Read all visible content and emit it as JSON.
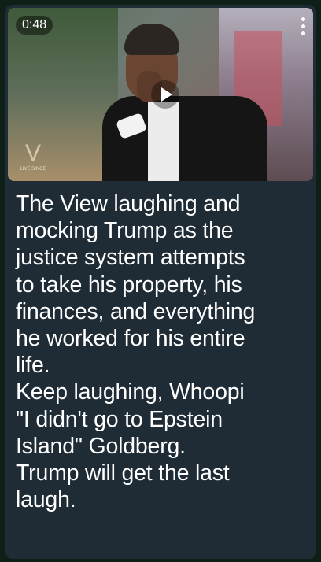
{
  "video": {
    "duration": "0:48",
    "logo_text": "V",
    "logo_caption": "LIVE\nSINCE"
  },
  "caption": "The View laughing and\nmocking Trump as the\njustice system attempts\nto take his property, his\nfinances, and everything\nhe worked for his entire\nlife.\nKeep laughing, Whoopi\n\"I didn't go to Epstein\nIsland\" Goldberg.\nTrump will get the last\nlaugh.",
  "icons": {
    "menu": "more-vertical-icon",
    "play": "play-icon"
  },
  "colors": {
    "background": "#0e1f17",
    "bubble": "#1f2c36",
    "text": "#ffffff"
  }
}
